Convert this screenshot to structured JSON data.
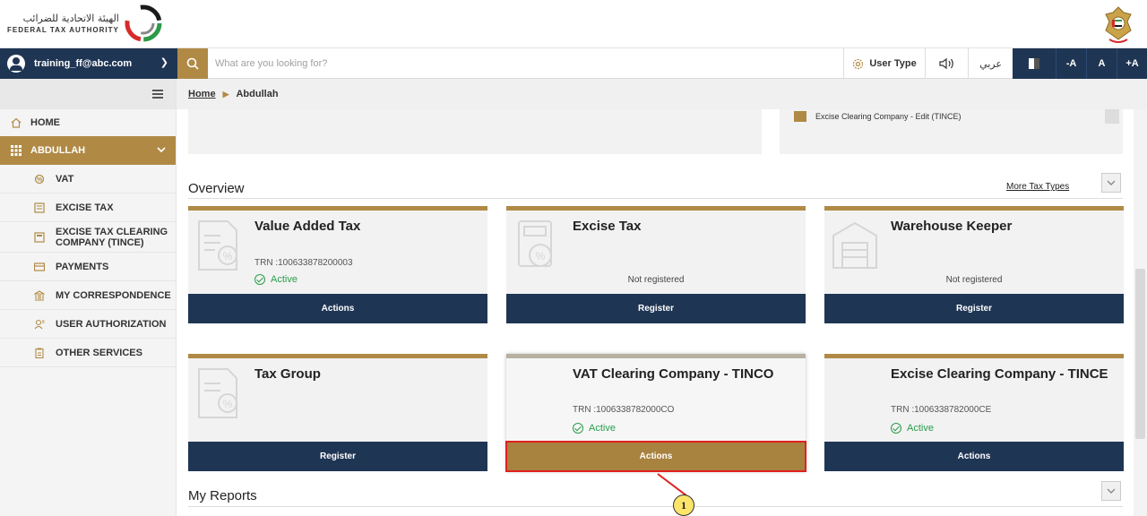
{
  "header": {
    "logo_arabic": "الهيئة الاتحادية للضرائب",
    "logo_english": "FEDERAL TAX AUTHORITY"
  },
  "topbar": {
    "user_email": "training_ff@abc.com",
    "search_placeholder": "What are you looking for?",
    "user_type_label": "User Type",
    "language_label": "عربي",
    "font_decrease": "-A",
    "font_normal": "A",
    "font_increase": "+A"
  },
  "sidebar": {
    "home": "HOME",
    "group": "ABDULLAH",
    "items": [
      {
        "label": "VAT"
      },
      {
        "label": "EXCISE TAX"
      },
      {
        "label": "EXCISE TAX CLEARING COMPANY (TINCE)"
      },
      {
        "label": "PAYMENTS"
      },
      {
        "label": "MY CORRESPONDENCE"
      },
      {
        "label": "USER AUTHORIZATION"
      },
      {
        "label": "OTHER SERVICES"
      }
    ]
  },
  "breadcrumb": {
    "home": "Home",
    "current": "Abdullah"
  },
  "top_item": {
    "label": "Excise Clearing Company - Edit (TINCE)"
  },
  "overview": {
    "title": "Overview",
    "more_link": "More Tax Types",
    "cards": [
      {
        "title": "Value Added Tax",
        "trn": "TRN :100633878200003",
        "status": "Active",
        "button": "Actions"
      },
      {
        "title": "Excise Tax",
        "note": "Not registered",
        "button": "Register"
      },
      {
        "title": "Warehouse Keeper",
        "note": "Not registered",
        "button": "Register"
      },
      {
        "title": "Tax Group",
        "button": "Register"
      },
      {
        "title": "VAT Clearing Company - TINCO",
        "trn": "TRN :1006338782000CO",
        "status": "Active",
        "button": "Actions"
      },
      {
        "title": "Excise Clearing Company - TINCE",
        "trn": "TRN :1006338782000CE",
        "status": "Active",
        "button": "Actions"
      }
    ]
  },
  "reports": {
    "title": "My Reports"
  },
  "callout": {
    "number": "1"
  },
  "colors": {
    "navy": "#1f3554",
    "gold": "#b08a45",
    "active_green": "#2a9d4b",
    "highlight_red": "#e02020"
  }
}
